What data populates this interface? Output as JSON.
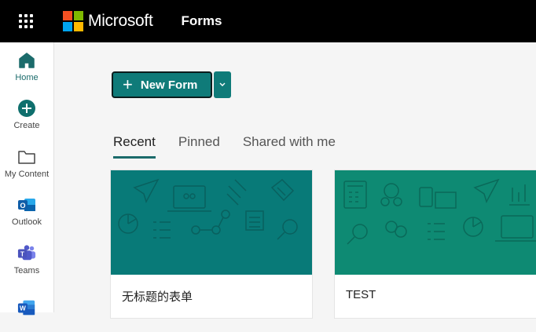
{
  "header": {
    "brand": "Microsoft",
    "app_name": "Forms",
    "logo_colors": [
      "#f25022",
      "#7fba00",
      "#00a4ef",
      "#ffb900"
    ]
  },
  "sidebar": {
    "items": [
      {
        "label": "Home",
        "icon": "home-icon",
        "active": true
      },
      {
        "label": "Create",
        "icon": "plus-circle-icon"
      },
      {
        "label": "My Content",
        "icon": "folder-icon"
      },
      {
        "label": "Outlook",
        "icon": "outlook-icon"
      },
      {
        "label": "Teams",
        "icon": "teams-icon"
      },
      {
        "label": "",
        "icon": "word-icon"
      }
    ]
  },
  "main": {
    "new_form_label": "New Form",
    "tabs": [
      {
        "label": "Recent",
        "active": true
      },
      {
        "label": "Pinned"
      },
      {
        "label": "Shared with me"
      }
    ],
    "cards": [
      {
        "title": "无标题的表单",
        "color": "#087a78"
      },
      {
        "title": "TEST",
        "color": "#0e8a73"
      }
    ]
  },
  "colors": {
    "accent": "#0f7b79",
    "topbar": "#000000"
  }
}
